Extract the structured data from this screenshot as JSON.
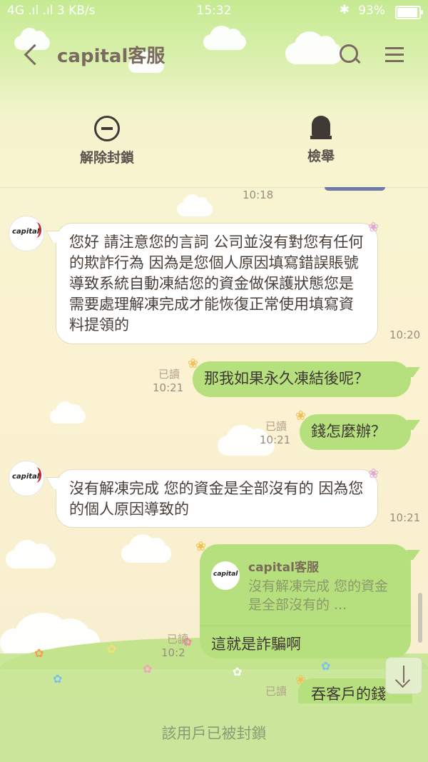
{
  "status": {
    "network": "4G .ıl .ıl 3 KB/s",
    "time": "15:32",
    "battery": "93%"
  },
  "header": {
    "title": "capital客服"
  },
  "actions": {
    "unblock_label": "解除封鎖",
    "report_label": "檢舉"
  },
  "contact": {
    "avatar_text": "capital"
  },
  "messages": [
    {
      "side": "in",
      "time": "10:18",
      "text": ""
    },
    {
      "side": "in",
      "time": "10:20",
      "text": "您好 請注意您的言詞 公司並沒有對您有任何的欺詐行為 因為是您個人原因填寫錯誤賬號導致系統自動凍結您的資金做保護狀態您是需要處理解凍完成才能恢復正常使用填寫資料提領的"
    },
    {
      "side": "out",
      "read": "已讀",
      "time": "10:21",
      "text": "那我如果永久凍結後呢？"
    },
    {
      "side": "out",
      "read": "已讀",
      "time": "10:21",
      "text": "錢怎麼辦？"
    },
    {
      "side": "in",
      "time": "10:21",
      "text": "沒有解凍完成 您的資金是全部沒有的 因為您的個人原因導致的"
    },
    {
      "side": "out",
      "read": "已讀",
      "time": "10:2",
      "reply_to_name": "capital客服",
      "reply_to_text": "沒有解凍完成 您的資金是全部沒有的 ...",
      "text": "這就是詐騙啊"
    },
    {
      "side": "out",
      "read": "已讀",
      "text": "吞客戶的錢"
    }
  ],
  "footer": {
    "blocked_text": "該用戶已被封鎖"
  },
  "colors": {
    "bubble_out": "#b6df7d",
    "bubble_in": "#ffffff",
    "header_text": "#7a6a60"
  }
}
